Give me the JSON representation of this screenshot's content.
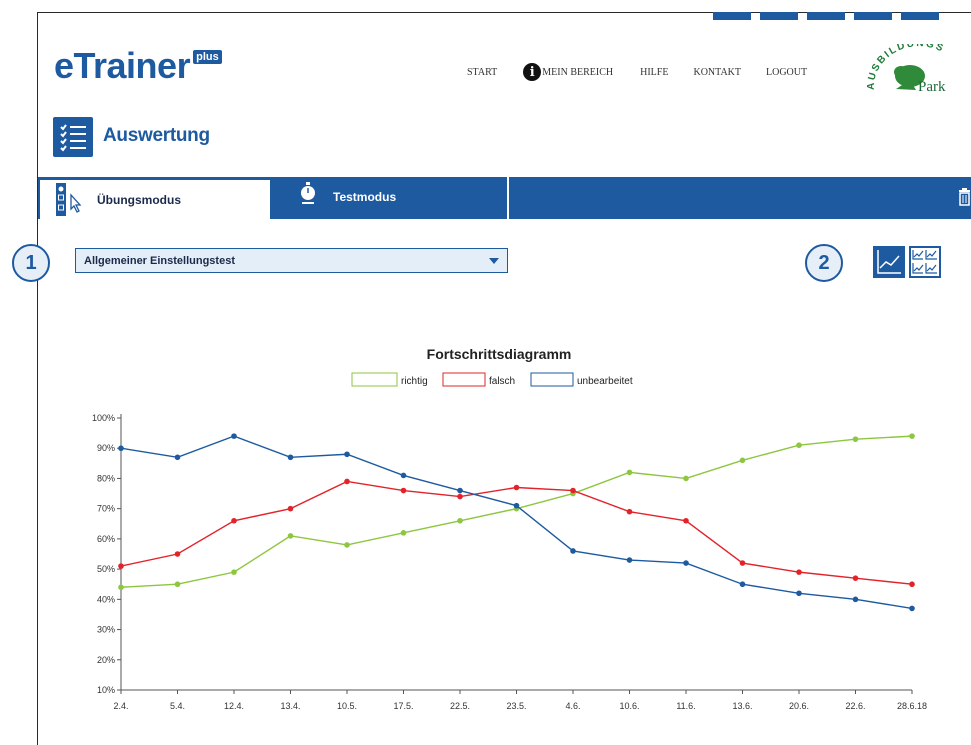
{
  "brand": {
    "name": "eTrainer",
    "badge": "plus"
  },
  "nav": {
    "start": "START",
    "mein_bereich": "MEIN BEREICH",
    "hilfe": "HILFE",
    "kontakt": "KONTAKT",
    "logout": "LOGOUT"
  },
  "partner": {
    "top": "AUSBILDUNGS",
    "bottom": "Park"
  },
  "section": {
    "title": "Auswertung"
  },
  "tabs": {
    "uebungsmodus": "Übungsmodus",
    "testmodus": "Testmodus"
  },
  "markers": {
    "one": "1",
    "two": "2"
  },
  "select": {
    "value": "Allgemeiner Einstellungstest"
  },
  "colors": {
    "brand": "#1e5aa0",
    "richtig": "#8dc63f",
    "falsch": "#e2232a",
    "unbearbeitet": "#1e5aa0"
  },
  "icons": [
    "checklist-icon",
    "info-icon",
    "cursor-select-icon",
    "stopwatch-icon",
    "trash-icon",
    "line-chart-icon",
    "multi-chart-icon",
    "chevron-down-icon"
  ],
  "chart_data": {
    "type": "line",
    "title": "Fortschrittsdiagramm",
    "xlabel": "",
    "ylabel": "",
    "categories": [
      "2.4.",
      "5.4.",
      "12.4.",
      "13.4.",
      "10.5.",
      "17.5.",
      "22.5.",
      "23.5.",
      "4.6.",
      "10.6.",
      "11.6.",
      "13.6.",
      "20.6.",
      "22.6.",
      "28.6.18"
    ],
    "yticks": [
      "10%",
      "20%",
      "30%",
      "40%",
      "50%",
      "60%",
      "70%",
      "80%",
      "90%",
      "100%"
    ],
    "ylim": [
      10,
      100
    ],
    "grid": false,
    "legend_position": "top-center",
    "series": [
      {
        "name": "richtig",
        "color": "#8dc63f",
        "values": [
          44,
          45,
          49,
          61,
          58,
          62,
          66,
          70,
          75,
          82,
          80,
          86,
          91,
          93,
          94
        ]
      },
      {
        "name": "falsch",
        "color": "#e2232a",
        "values": [
          51,
          55,
          66,
          70,
          79,
          76,
          74,
          77,
          76,
          69,
          66,
          52,
          49,
          47,
          45
        ]
      },
      {
        "name": "unbearbeitet",
        "color": "#1e5aa0",
        "values": [
          90,
          87,
          94,
          87,
          88,
          81,
          76,
          71,
          56,
          53,
          52,
          45,
          42,
          40,
          37
        ]
      }
    ]
  }
}
